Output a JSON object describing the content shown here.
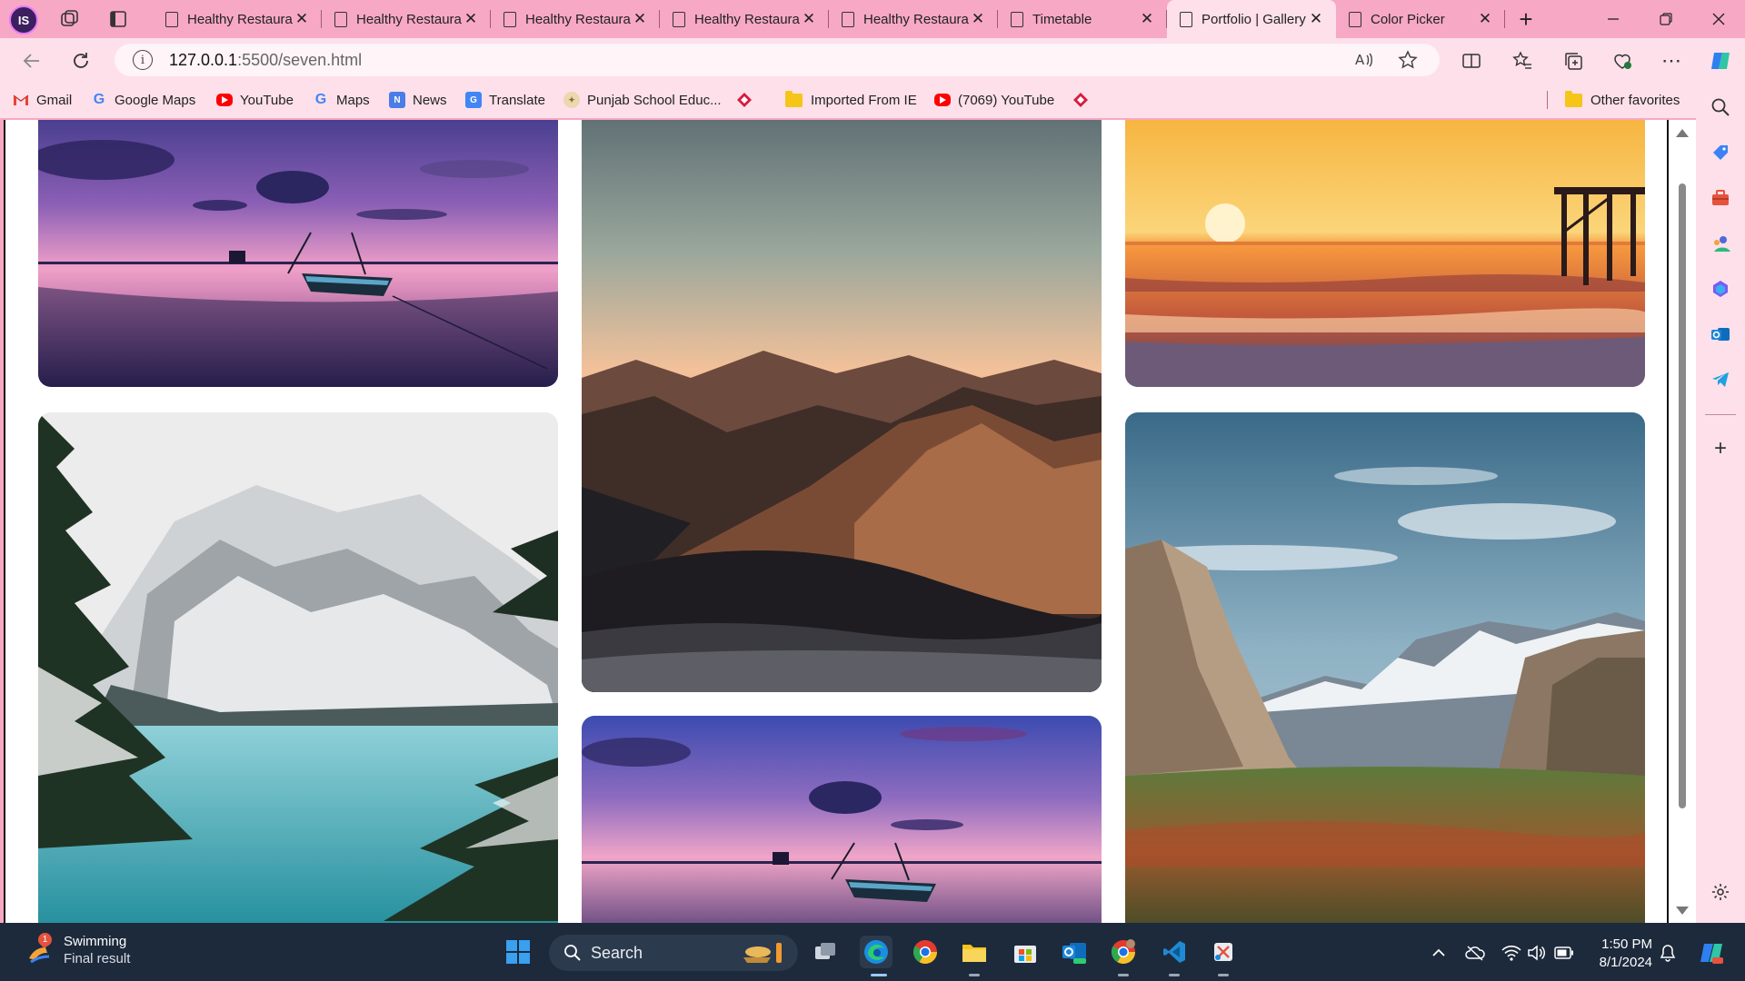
{
  "browser": {
    "profile_initials": "IS",
    "tabs": [
      {
        "title": "Healthy Restaurant",
        "active": false
      },
      {
        "title": "Healthy Restaurant",
        "active": false
      },
      {
        "title": "Healthy Restaurant",
        "active": false
      },
      {
        "title": "Healthy Restaurant",
        "active": false
      },
      {
        "title": "Healthy Restaurant",
        "active": false
      },
      {
        "title": "Timetable",
        "active": false
      },
      {
        "title": "Portfolio | Gallery",
        "active": true
      },
      {
        "title": "Color Picker",
        "active": false
      }
    ],
    "url_host": "127.0.0.1",
    "url_path": ":5500/seven.html"
  },
  "bookmarks": {
    "items": [
      {
        "label": "Gmail",
        "icon": "gmail-icon"
      },
      {
        "label": "Google Maps",
        "icon": "google-icon"
      },
      {
        "label": "YouTube",
        "icon": "youtube-icon"
      },
      {
        "label": "Maps",
        "icon": "google-icon"
      },
      {
        "label": "News",
        "icon": "news-icon"
      },
      {
        "label": "Translate",
        "icon": "translate-icon"
      },
      {
        "label": "Punjab School Educ...",
        "icon": "school-icon"
      },
      {
        "label": "Imported From IE",
        "icon": "folder-icon"
      },
      {
        "label": "(7069) YouTube",
        "icon": "youtube-icon"
      }
    ],
    "other_favorites": "Other favorites"
  },
  "gallery": {
    "photos": [
      {
        "name": "photo-sunset-boat-lake",
        "column": 1
      },
      {
        "name": "photo-snowy-mountain-lake",
        "column": 1
      },
      {
        "name": "photo-mountain-range-dusk",
        "column": 2
      },
      {
        "name": "photo-sunset-boat-lake-2",
        "column": 2
      },
      {
        "name": "photo-beach-sunset-pier",
        "column": 3
      },
      {
        "name": "photo-yosemite-valley",
        "column": 3
      }
    ]
  },
  "taskbar": {
    "weather_title": "Swimming",
    "weather_subtitle": "Final result",
    "weather_badge": "1",
    "search_label": "Search",
    "time": "1:50 PM",
    "date": "8/1/2024"
  },
  "colors": {
    "browser_frame": "#f7a8c4",
    "toolbar": "#fde0ea",
    "taskbar": "#1d2a3c"
  }
}
